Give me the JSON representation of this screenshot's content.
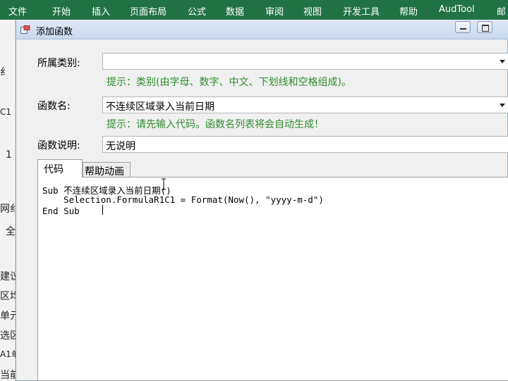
{
  "ribbon": {
    "tabs": [
      "文件",
      "开始",
      "插入",
      "页面布局",
      "公式",
      "数据",
      "审阅",
      "视图",
      "开发工具",
      "帮助",
      "AudTool",
      "邮"
    ]
  },
  "background": {
    "fragments": [
      "纟",
      "C1",
      "1",
      "网纟",
      "全",
      "建议",
      "区均",
      "单元",
      "选区",
      "A1单",
      "当前"
    ]
  },
  "dialog": {
    "title": "添加函数",
    "category_label": "所属类别:",
    "category_value": "",
    "category_hint": "提示：类别(由字母、数字、中文、下划线和空格组成)。",
    "name_label": "函数名:",
    "name_value": "不连续区域录入当前日期",
    "name_hint": "提示：请先输入代码。函数名列表将会自动生成！",
    "desc_label": "函数说明:",
    "desc_value": "无说明",
    "tabs": [
      "代码",
      "帮助动画"
    ],
    "code_lines": [
      "Sub 不连续区域录入当前日期()",
      "    Selection.FormulaR1C1 = Format(Now(), \"yyyy-m-d\")",
      "End Sub"
    ]
  },
  "colors": {
    "ribbon": "#217346",
    "hint": "#2e8b2e",
    "dialog_bg": "#f0f0f0"
  }
}
